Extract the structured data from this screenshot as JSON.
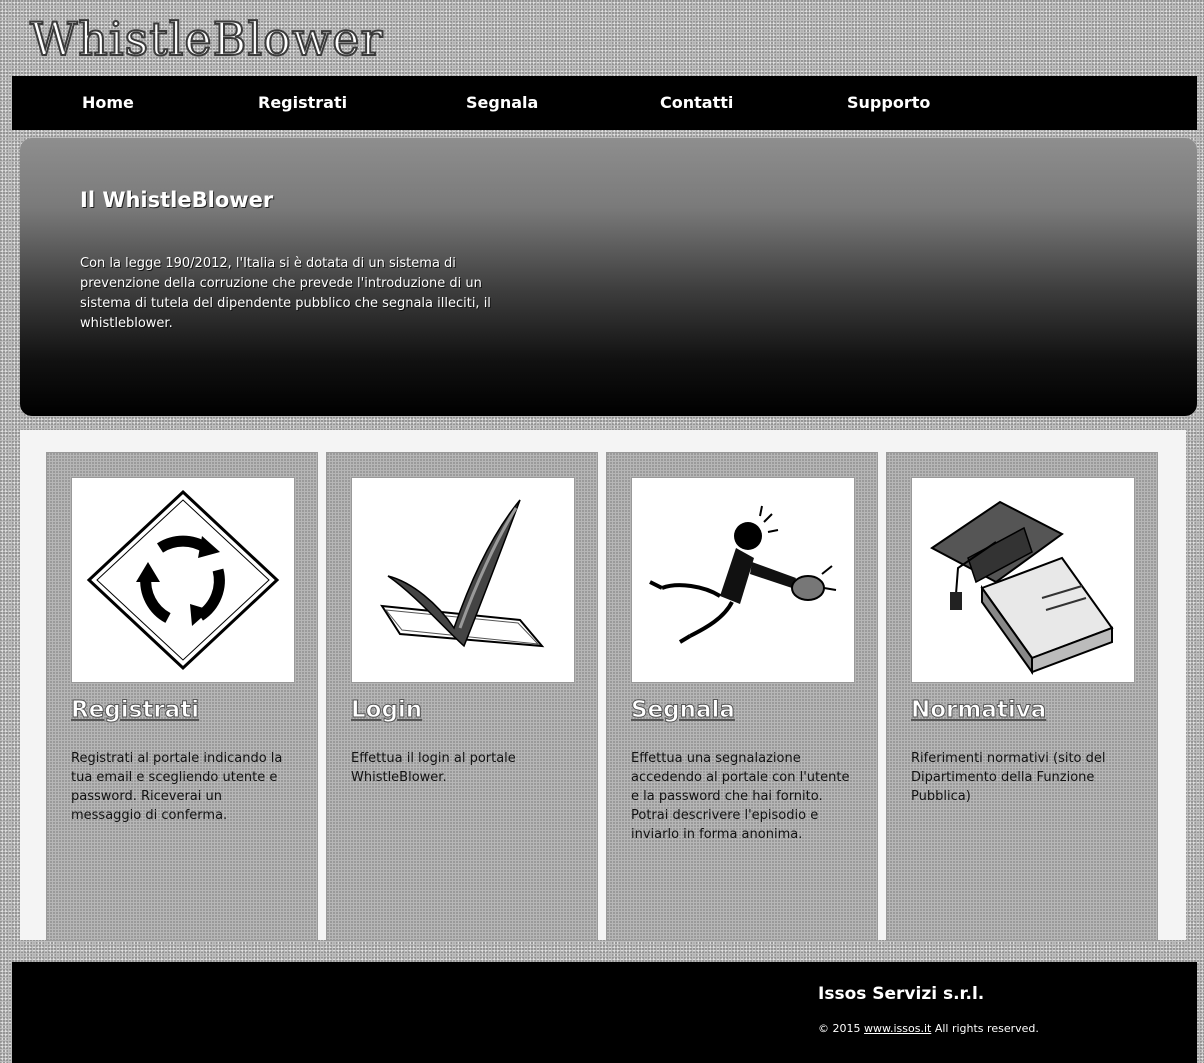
{
  "header": {
    "brand": "WhistleBlower"
  },
  "nav": {
    "items": [
      {
        "label": "Home"
      },
      {
        "label": "Registrati"
      },
      {
        "label": "Segnala"
      },
      {
        "label": "Contatti"
      },
      {
        "label": "Supporto"
      }
    ]
  },
  "hero": {
    "title": "Il WhistleBlower",
    "text": "Con la legge 190/2012, l'Italia si è dotata di un sistema di prevenzione della corruzione che prevede l'introduzione di un sistema di tutela del dipendente pubblico che segnala illeciti, il whistleblower."
  },
  "cards": [
    {
      "icon": "roundabout-sign-icon",
      "title": "Registrati",
      "text": "Registrati al portale indicando la tua email e scegliendo utente e password. Riceverai un messaggio di conferma."
    },
    {
      "icon": "checkmark-icon",
      "title": "Login",
      "text": "Effettua il login al portale WhistleBlower."
    },
    {
      "icon": "whistleblower-figure-icon",
      "title": "Segnala",
      "text": "Effettua una segnalazione accedendo al portale con l'utente e la password che hai fornito. Potrai descrivere l'episodio e inviarlo in forma anonima."
    },
    {
      "icon": "graduation-cap-book-icon",
      "title": "Normativa",
      "text": "Riferimenti normativi (sito del Dipartimento della Funzione Pubblica)"
    }
  ],
  "footer": {
    "company": "Issos Servizi s.r.l.",
    "copyright_prefix": "© 2015",
    "link_text": "www.issos.it",
    "copyright_suffix": "All rights reserved."
  }
}
